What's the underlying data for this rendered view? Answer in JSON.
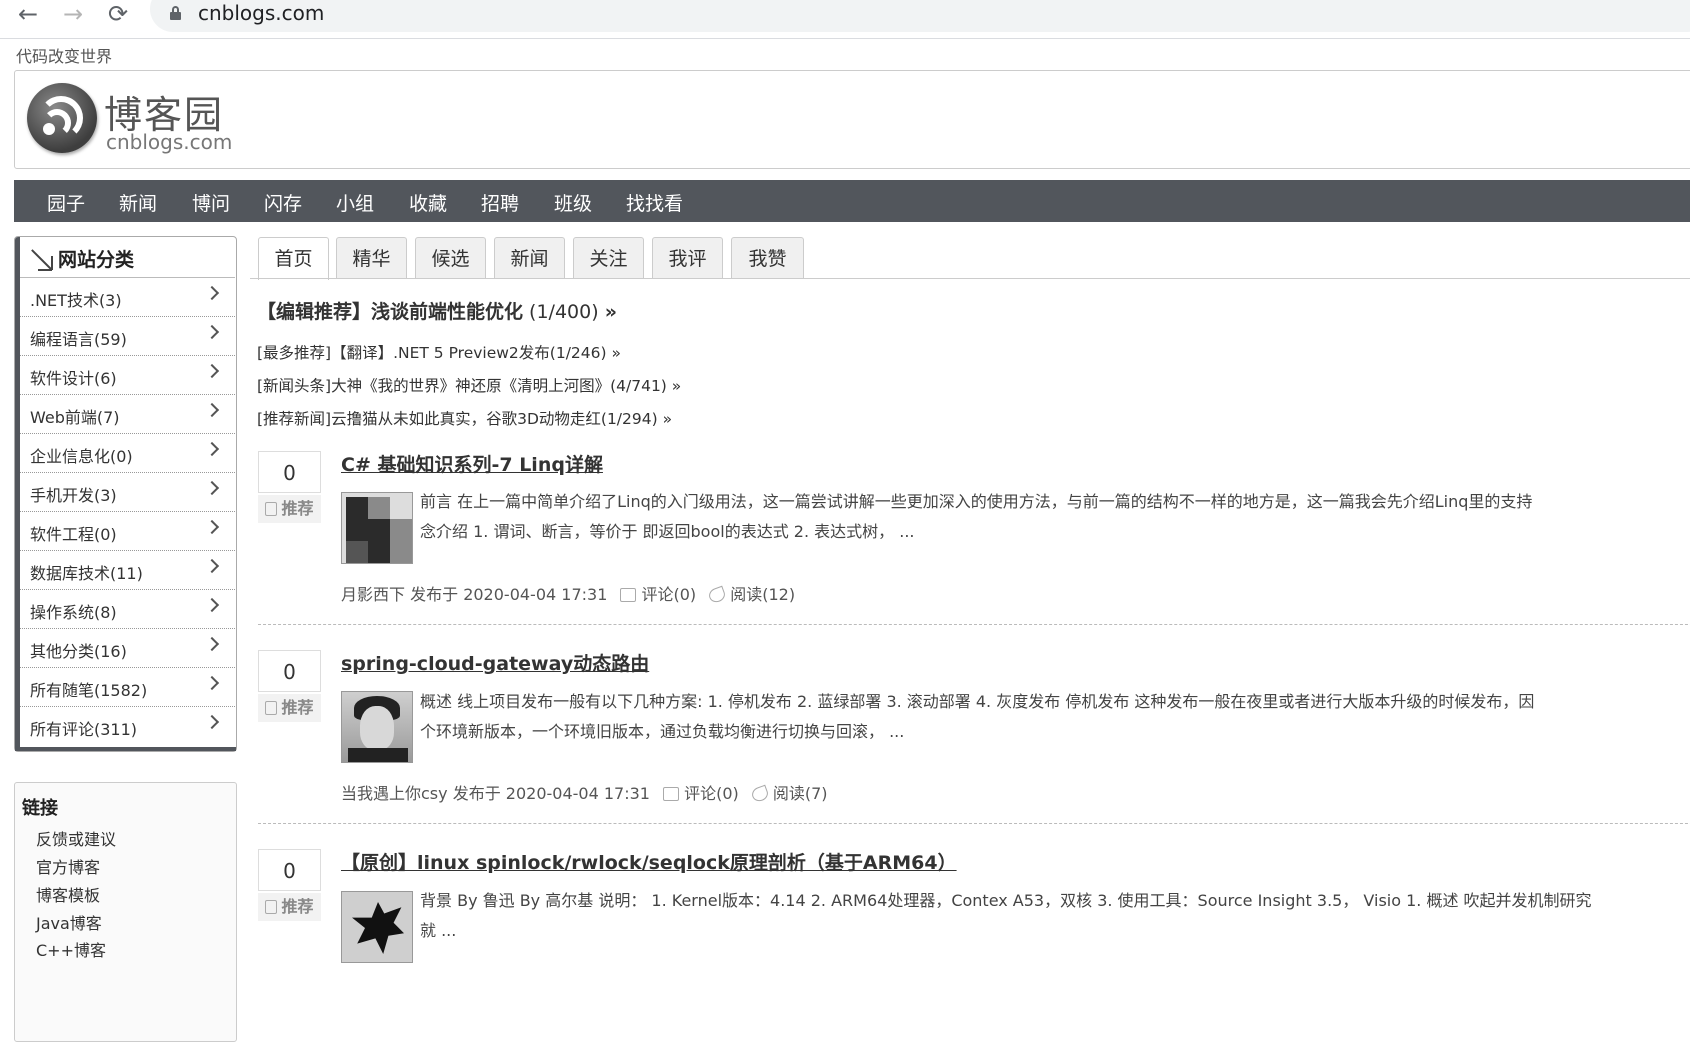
{
  "browser": {
    "url": "cnblogs.com",
    "back_icon": "←",
    "forward_icon": "→",
    "reload_icon": "⟳"
  },
  "site": {
    "slogan": "代码改变世界",
    "logo_cn": "博客园",
    "logo_en": "cnblogs.com"
  },
  "main_nav": [
    "园子",
    "新闻",
    "博问",
    "闪存",
    "小组",
    "收藏",
    "招聘",
    "班级",
    "找找看"
  ],
  "sidebar": {
    "title": "网站分类",
    "categories": [
      ".NET技术(3)",
      "编程语言(59)",
      "软件设计(6)",
      "Web前端(7)",
      "企业信息化(0)",
      "手机开发(3)",
      "软件工程(0)",
      "数据库技术(11)",
      "操作系统(8)",
      "其他分类(16)",
      "所有随笔(1582)",
      "所有评论(311)"
    ],
    "links_title": "链接",
    "links": [
      "反馈或建议",
      "官方博客",
      "博客模板",
      "Java博客",
      "C++博客"
    ]
  },
  "tabs": [
    "首页",
    "精华",
    "候选",
    "新闻",
    "关注",
    "我评",
    "我赞"
  ],
  "headline": {
    "text": "【编辑推荐】浅谈前端性能优化",
    "count": " (1/400) ",
    "more": "»"
  },
  "news": [
    "[最多推荐]【翻译】.NET 5 Preview2发布(1/246) »",
    "[新闻头条]大神《我的世界》神还原《清明上河图》(4/741) »",
    "[推荐新闻]云撸猫从未如此真实，谷歌3D动物走红(1/294) »"
  ],
  "recommend_label": "推荐",
  "posts": [
    {
      "digg": "0",
      "title": "C# 基础知识系列-7 Linq详解",
      "summary_1": "前言 在上一篇中简单介绍了Linq的入门级用法，这一篇尝试讲解一些更加深入的使用方法，与前一篇的结构不一样的地方是，这一篇我会先介绍Linq里的支持",
      "summary_2": "念介绍 1. 谓词、断言，等价于 即返回bool的表达式 2. 表达式树， ...",
      "author": "月影西下",
      "published": "发布于 2020-04-04 17:31",
      "comments": "评论(0)",
      "reads": "阅读(12)"
    },
    {
      "digg": "0",
      "title": "spring-cloud-gateway动态路由",
      "summary_1": "概述 线上项目发布一般有以下几种方案: 1. 停机发布 2. 蓝绿部署 3. 滚动部署 4. 灰度发布 停机发布 这种发布一般在夜里或者进行大版本升级的时候发布，因",
      "summary_2": "个环境新版本，一个环境旧版本，通过负载均衡进行切换与回滚， ...",
      "author": "当我遇上你csy",
      "published": "发布于 2020-04-04 17:31",
      "comments": "评论(0)",
      "reads": "阅读(7)"
    },
    {
      "digg": "0",
      "title": "【原创】linux spinlock/rwlock/seqlock原理剖析（基于ARM64）",
      "summary_1": "背景 By 鲁迅 By 高尔基 说明： 1. Kernel版本：4.14 2. ARM64处理器，Contex A53，双核 3. 使用工具：Source Insight 3.5， Visio 1. 概述 吹起并发机制研究",
      "summary_2": "就 ..."
    }
  ]
}
